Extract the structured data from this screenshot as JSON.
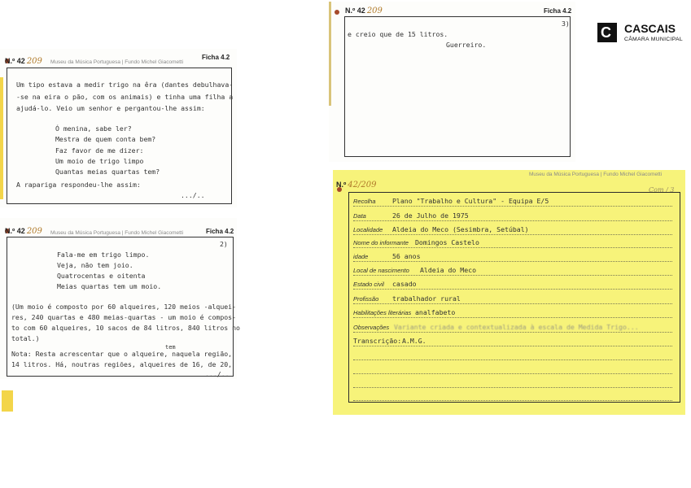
{
  "logo": {
    "name": "CASCAIS",
    "subtitle": "CÂMARA MUNICIPAL"
  },
  "card1": {
    "number_label": "N.º 42",
    "number_hand": "209",
    "museum": "Museu da Música Portuguesa | Fundo Michel Giacometti",
    "ficha": "Ficha 4.2",
    "lines": [
      "Um tipo estava a medir trigo na êra (dantes debulhava-",
      "-se na eira o pão, com os animais) e tinha uma filha a",
      "ajudá-lo. Veio um senhor e pergantou-lhe assim:",
      "Ó menina, sabe ler?",
      "Mestra de quem conta bem?",
      "Faz favor de me dizer:",
      "Um moio de trigo limpo",
      "Quantas meias quartas tem?",
      "A rapariga respondeu-lhe assim:",
      ".../.."
    ]
  },
  "card2": {
    "number_label": "N.º 42",
    "number_hand": "209",
    "museum": "Museu da Música Portuguesa | Fundo Michel Giacometti",
    "ficha": "Ficha 4.2",
    "page": "2)",
    "lines": [
      "Fala-me em trigo limpo.",
      "Veja, não tem joio.",
      "Quatrocentas e oitenta",
      "Meias quartas tem um moio.",
      "(Um moio é composto por 60 alqueires, 120 meios -alquei-",
      "res, 240 quartas e 480 meias-quartas - um moio é compos-",
      "to com 60 alqueires, 10 sacos de 84 litros, 840 litros no",
      "total.)",
      "tem",
      "Nota: Resta acrescentar que o alqueire, naquela região,",
      "14 litros. Há, noutras regiões, alqueires de 16, de 20,",
      ".../.."
    ]
  },
  "card3": {
    "number_label": "N.º 42",
    "number_hand": "209",
    "ficha": "Ficha 4.2",
    "page": "3)",
    "lines": [
      "e creio que de 15 litros.",
      "Guerreiro."
    ]
  },
  "card4": {
    "number_label": "N.º",
    "number_hand": "42/209",
    "museum": "Museu da Música Portuguesa | Fundo Michel Giacometti",
    "corner_note": "Com / 3",
    "fields": [
      {
        "label": "Recolha",
        "value": "Plano \"Trabalho e Cultura\"  -  Equipa E/5"
      },
      {
        "label": "Data",
        "value": "26 de Julho de 1975"
      },
      {
        "label": "Localidade",
        "value": "Aldeia do Meco (Sesimbra, Setúbal)"
      },
      {
        "label": "Nome do informante",
        "value": "Domingos Castelo"
      },
      {
        "label": "idade",
        "value": "56 anos"
      },
      {
        "label": "Local de nascimento",
        "value": "Aldeia do Meco"
      },
      {
        "label": "Estado civil",
        "value": "casado"
      },
      {
        "label": "Profissão",
        "value": "trabalhador rural"
      },
      {
        "label": "Habilitações literárias",
        "value": "analfabeto"
      },
      {
        "label": "Observações",
        "value": "Variante criada e contextualizada à escala de Medida Trigo..."
      },
      {
        "label": "Transcrição:",
        "value": "A.M.G."
      }
    ]
  },
  "colors": {
    "yellow_card": "#f7f37a",
    "handwriting": "#b07a2a",
    "pin": "#a64a2a"
  }
}
